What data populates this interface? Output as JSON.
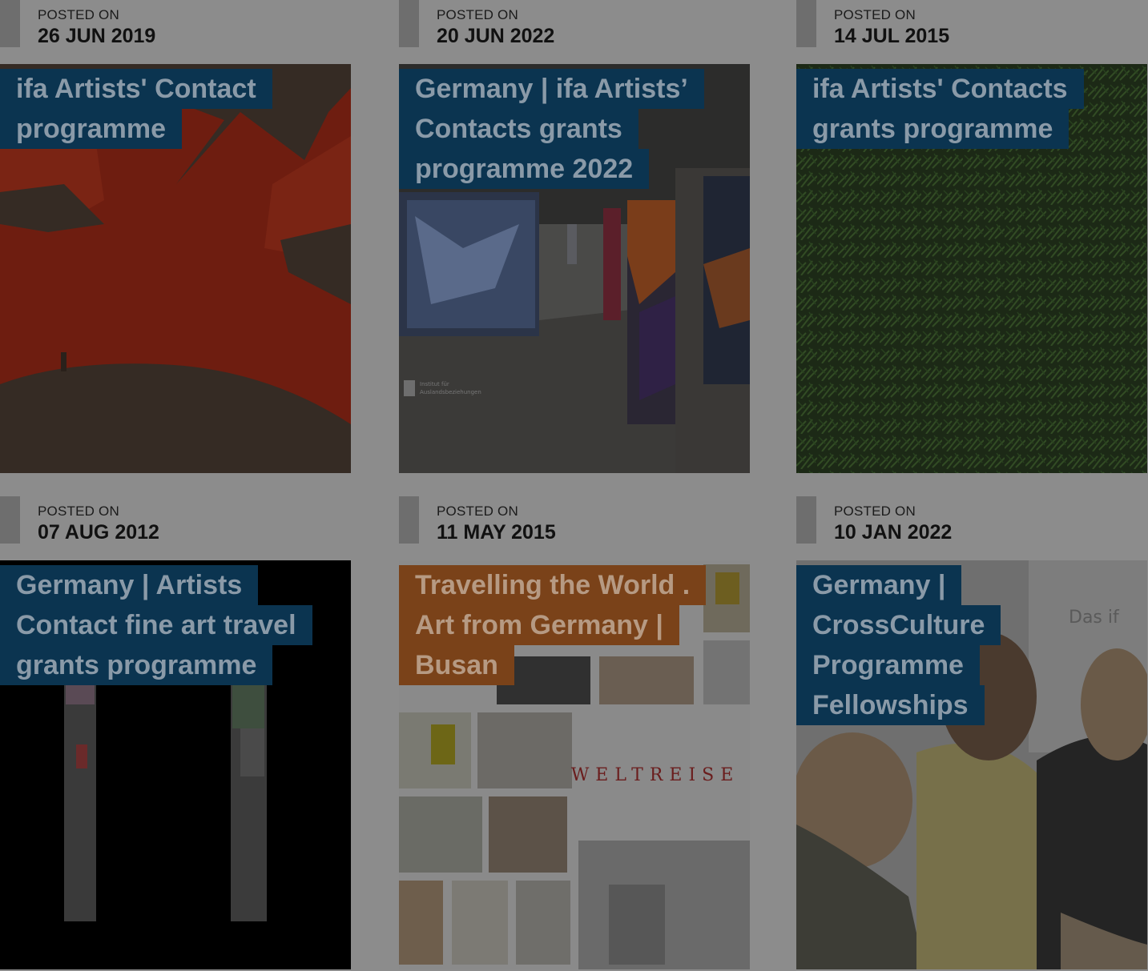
{
  "posts": [
    {
      "posted_label": "POSTED ON",
      "date": "26 JUN 2019",
      "title": "ifa Artists' Contact programme",
      "title_style": "blue"
    },
    {
      "posted_label": "POSTED ON",
      "date": "20 JUN 2022",
      "title": "Germany | ifa Artists’ Contacts grants programme 2022",
      "title_style": "blue"
    },
    {
      "posted_label": "POSTED ON",
      "date": "14 JUL 2015",
      "title": "ifa Artists' Contacts grants programme",
      "title_style": "blue"
    },
    {
      "posted_label": "POSTED ON",
      "date": "07 AUG 2012",
      "title": "Germany | Artists Contact fine art travel grants programme",
      "title_style": "blue"
    },
    {
      "posted_label": "POSTED ON",
      "date": "11 MAY 2015",
      "title": "Travelling the World . Art from Germany | Busan",
      "title_style": "orange"
    },
    {
      "posted_label": "POSTED ON",
      "date": "10 JAN 2022",
      "title": "Germany | CrossCulture Programme Fellowships",
      "title_style": "blue"
    }
  ],
  "thumb3_text": {
    "weltreise": "WELTREISE",
    "logo_line1": "Institut für",
    "logo_line2": "Auslandsbeziehungen"
  },
  "thumb6_text": {
    "sign": "Das if"
  },
  "colors": {
    "title_blue": "#0b3450",
    "title_orange": "#7a4219",
    "overlay": "#8c8c8c"
  }
}
